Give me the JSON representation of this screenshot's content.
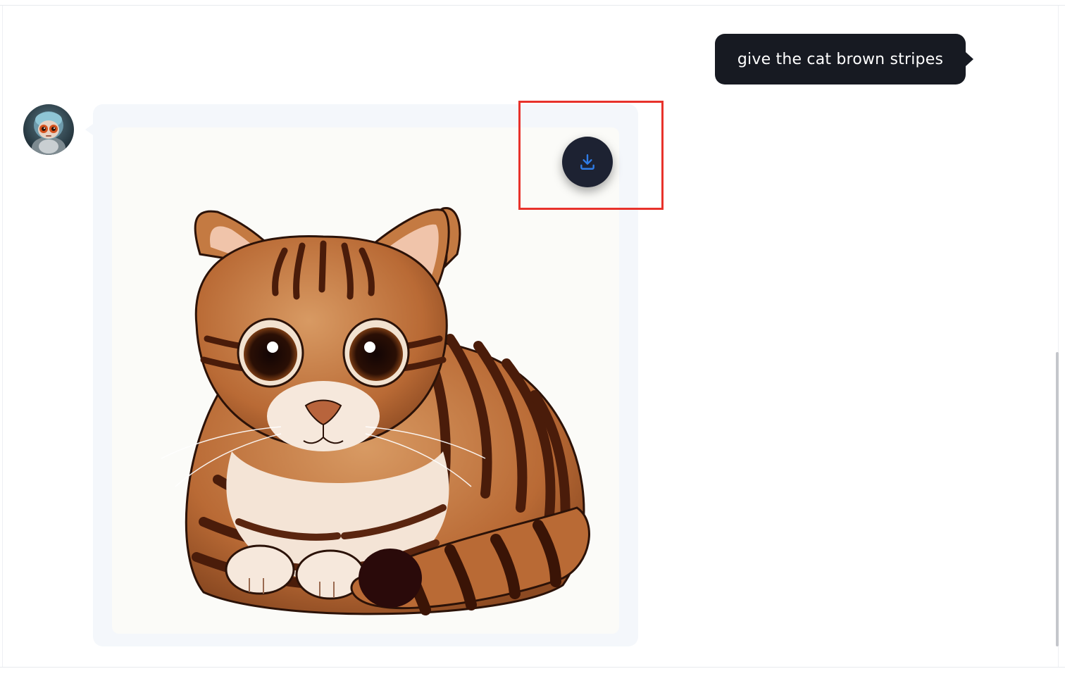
{
  "conversation": {
    "user_message": {
      "text": "give the cat brown stripes"
    },
    "assistant_message": {
      "avatar_icon": "robot-avatar",
      "image_description_icon": "tabby-cat-illustration",
      "download_icon": "download-icon"
    }
  },
  "colors": {
    "user_bubble": "#171a22",
    "assistant_card": "#f4f7fb",
    "download_button": "#1d2232",
    "download_icon": "#2f7de8",
    "highlight": "#e8322b"
  }
}
